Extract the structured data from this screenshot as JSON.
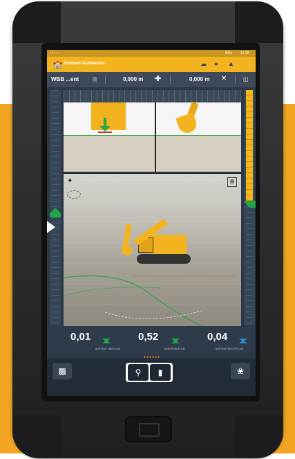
{
  "app": {
    "title": "Trimble® Earthworks",
    "status_time": "10:28",
    "battery": "83%"
  },
  "toolbar": {
    "design_name": "WBB ...ent",
    "offset_vertical": "0,000 m",
    "offset_horizontal": "0,000 m"
  },
  "readouts": [
    {
      "value": "0,01",
      "label": "AUFTRAG LINKS (1/4)",
      "color": "#1fa64a"
    },
    {
      "value": "0,52",
      "label": "AUSGEHALB (1/4)",
      "color": "#1fa64a"
    },
    {
      "value": "0,04",
      "label": "AUFTRAG RECHTS (1/4)",
      "color": "#2a8ad8"
    }
  ],
  "pager": "●●●●●●",
  "icons": {
    "logo": "trimble-logo-icon",
    "cloud": "cloud-icon",
    "bell": "bell-icon",
    "user": "user-icon",
    "menu": "menu-icon",
    "file": "file-icon",
    "plus": "crosshair-plus-icon",
    "close": "close-icon",
    "layers": "layers-icon"
  }
}
